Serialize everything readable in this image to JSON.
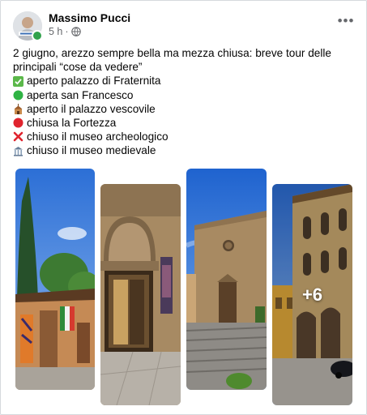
{
  "post": {
    "author": "Massimo Pucci",
    "time": "5 h",
    "separator": "·",
    "privacy_icon": "globe-icon",
    "more_icon": "more-options-icon",
    "intro": "2 giugno, arezzo sempre bella ma mezza chiusa: breve tour delle principali “cose da vedere”",
    "items": [
      {
        "icon": "check-mark-icon",
        "text": "aperto palazzo di Fraternita"
      },
      {
        "icon": "green-circle-icon",
        "text": "aperta san Francesco"
      },
      {
        "icon": "church-icon",
        "text": "aperto il palazzo vescovile"
      },
      {
        "icon": "red-circle-icon",
        "text": "chiusa la Fortezza"
      },
      {
        "icon": "cross-mark-icon",
        "text": "chiuso il museo archeologico"
      },
      {
        "icon": "museum-icon",
        "text": "chiuso il museo medievale"
      }
    ],
    "photos": [
      {
        "subject": "palazzo-fraternita"
      },
      {
        "subject": "doorway"
      },
      {
        "subject": "san-francesco"
      },
      {
        "subject": "street"
      }
    ],
    "more_photos": "+6"
  },
  "colors": {
    "online": "#31a24c",
    "text": "#050505",
    "secondary": "#65676b"
  }
}
